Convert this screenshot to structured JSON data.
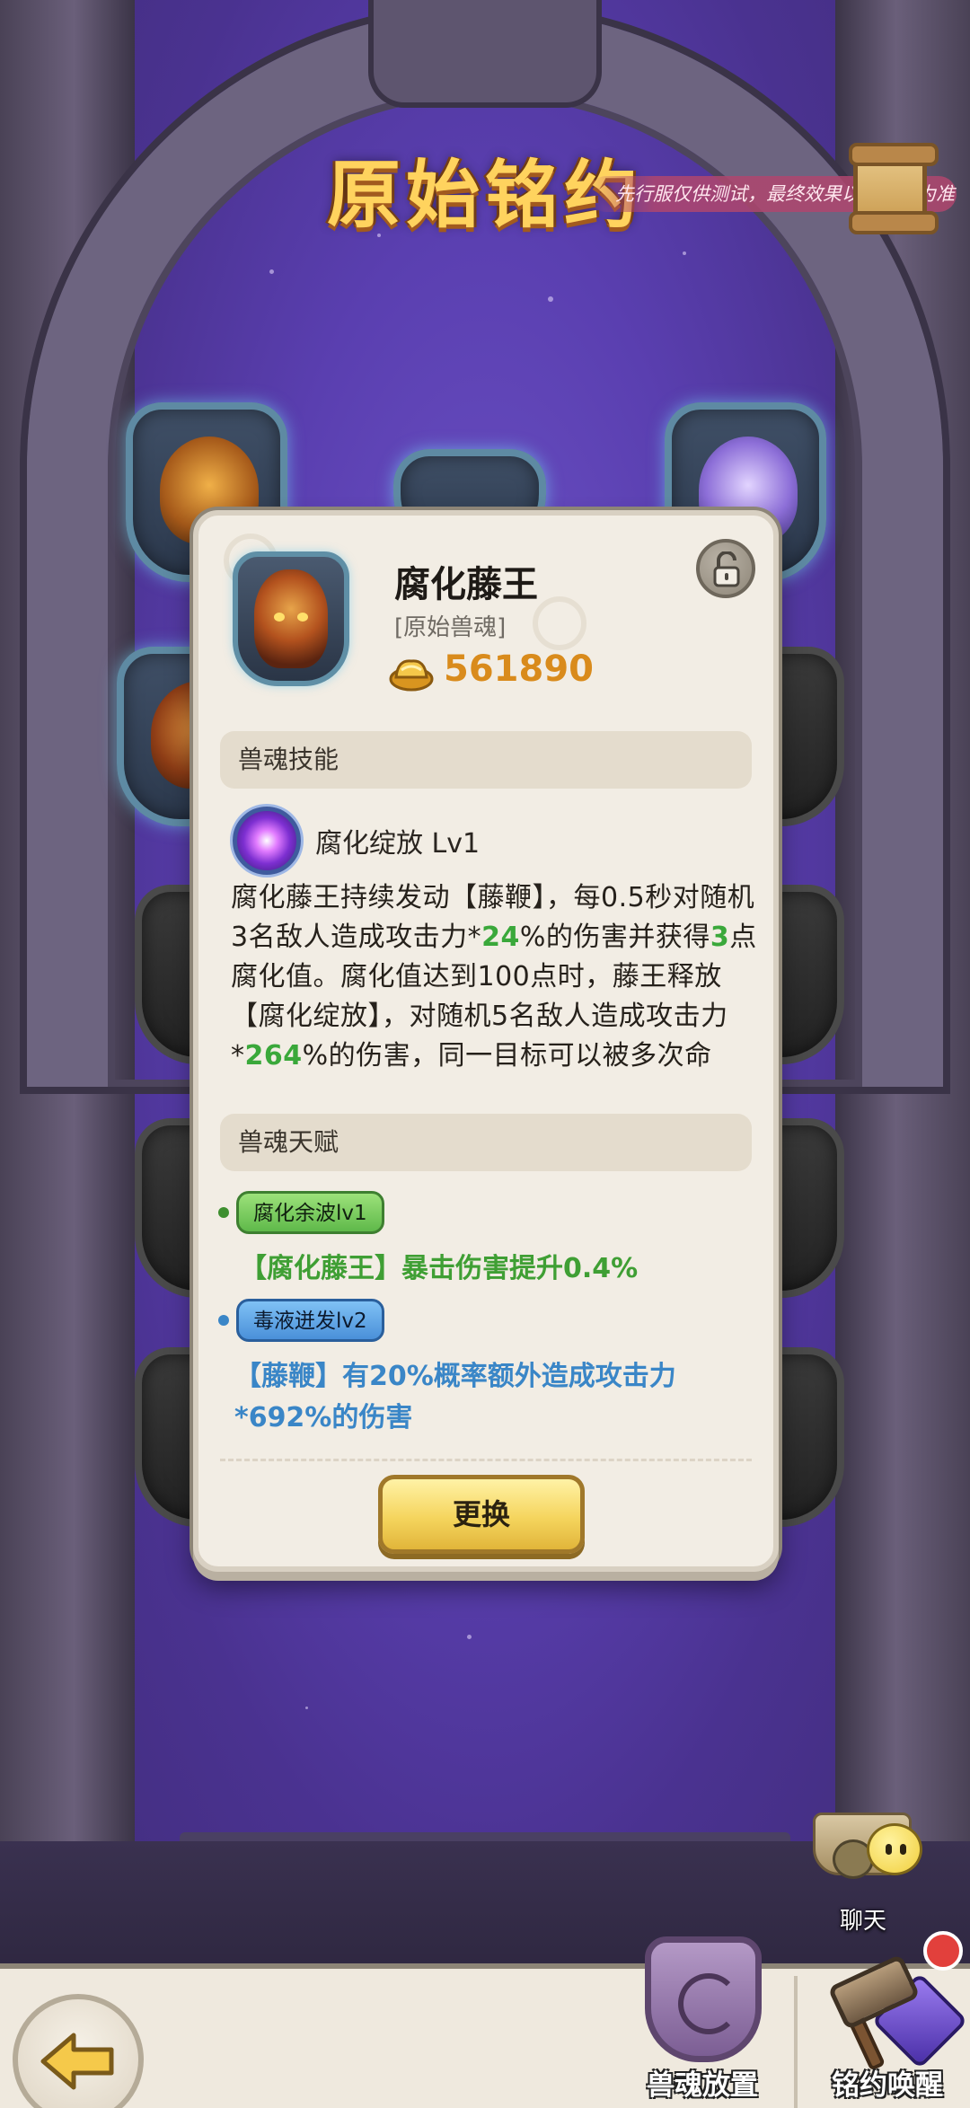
{
  "header": {
    "title": "原始铭约",
    "test_notice": "先行服仅供测试，最终效果以正式服为准"
  },
  "card": {
    "name": "腐化藤王",
    "subtitle": "[原始兽魂]",
    "coin_value": "561890",
    "skill_section_title": "兽魂技能",
    "skill": {
      "name": "腐化绽放 Lv1",
      "description_parts": [
        {
          "t": "腐化藤王持续发动【藤鞭】，每0.5秒对随机3名敌人造成攻击力*",
          "hl": false
        },
        {
          "t": "24",
          "hl": true
        },
        {
          "t": "%的伤害并获得",
          "hl": false
        },
        {
          "t": "3",
          "hl": true
        },
        {
          "t": "点腐化值。腐化值达到100点时，藤王释放【腐化绽放】，对随机5名敌人造成攻击力*",
          "hl": false
        },
        {
          "t": "264",
          "hl": true
        },
        {
          "t": "%的伤害，同一目标可以被多次命中，并消耗腐化值",
          "hl": false
        }
      ]
    },
    "talent_section_title": "兽魂天赋",
    "talents": [
      {
        "tag": "腐化余波lv1",
        "text": "【腐化藤王】暴击伤害提升0.4%"
      },
      {
        "tag": "毒液迸发lv2",
        "text": "【藤鞭】有20%概率额外造成攻击力*692%的伤害"
      }
    ],
    "swap_label": "更换"
  },
  "chat": {
    "label": "聊天"
  },
  "bottom_nav": {
    "place_label": "兽魂放置",
    "awaken_label": "铭约唤醒"
  },
  "icons": {
    "coin": "gold-ingot-icon",
    "lock": "unlocked-padlock-icon",
    "back": "yellow-back-arrow-icon"
  },
  "colors": {
    "title": "#ffd35e",
    "coin": "#d98b1c",
    "highlight_green": "#3aa83a",
    "talent_blue": "#3a86c7"
  }
}
